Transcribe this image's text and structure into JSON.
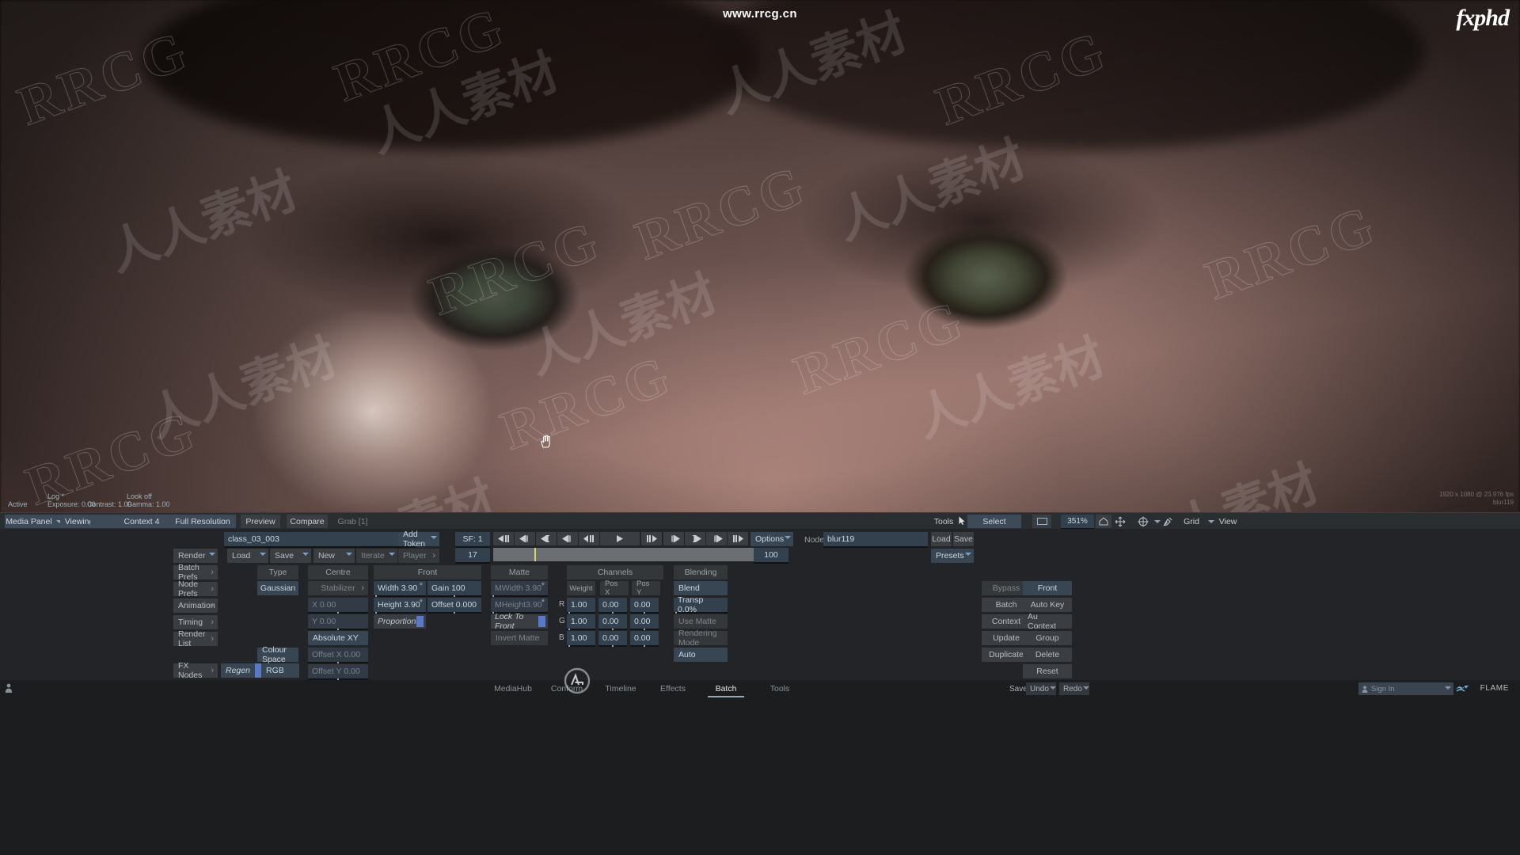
{
  "watermarks": {
    "url": "www.rrcg.cn",
    "brand": "fxphd",
    "rrcg": "RRCG",
    "cn": "人人素材"
  },
  "viewer": {
    "active_label": "Active",
    "log_label": "Log *",
    "exposure": "Exposure: 0.00",
    "contrast": "Contrast: 1.00",
    "lookoff": "Look off",
    "gamma": "Gamma: 1.00",
    "res_stamp_line1": "1920 x 1080 @ 23.976 fps",
    "res_stamp_line2": "blur119",
    "cursor_icon": "hand-cursor-icon"
  },
  "menubar": {
    "media_panel": "Media Panel",
    "viewing": "Viewing",
    "context": "Context 4",
    "full_resolution": "Full Resolution",
    "preview": "Preview",
    "compare": "Compare",
    "grab": "Grab [1]",
    "tools": "Tools",
    "select": "Select",
    "zoom_value": "351%",
    "grid": "Grid",
    "view": "View",
    "icons": {
      "pointer": "pointer-icon",
      "frame": "frame-icon",
      "home": "home-icon",
      "fit": "fit-to-screen-icon",
      "crosshair": "crosshair-icon",
      "eyedropper": "eyedropper-icon"
    }
  },
  "batch": {
    "setup_name": "class_03_003",
    "add_token": "Add Token",
    "left_column": [
      {
        "label": "Render",
        "style": "grey",
        "dropdown": true
      },
      {
        "label": "Batch Prefs",
        "style": "grey",
        "arrow": true
      },
      {
        "label": "Node Prefs",
        "style": "grey",
        "arrow": true
      },
      {
        "label": "Animation",
        "style": "grey",
        "arrow": true
      },
      {
        "label": "Timing",
        "style": "grey",
        "arrow": true
      },
      {
        "label": "Render List",
        "style": "grey",
        "arrow": true
      }
    ],
    "fx_nodes": "FX Nodes",
    "regen": "Regen",
    "rgb": "RGB",
    "colour_space": "Colour Space",
    "file_row": [
      {
        "label": "Load",
        "dropdown": true
      },
      {
        "label": "Save",
        "dropdown": true
      },
      {
        "label": "New",
        "dropdown": true
      },
      {
        "label": "Iterate",
        "dropdown": true
      },
      {
        "label": "Player",
        "arrow": true
      }
    ],
    "type": "Type",
    "gaussian": "Gaussian",
    "sf_field": "SF: 1",
    "frame_field": "17",
    "options": "Options",
    "options_value": "100",
    "node_label": "Node",
    "node_name": "blur119",
    "transport": [
      "pause-to-start-icon",
      "jump-to-prev-icon",
      "go-to-in-icon",
      "step-back-icon",
      "play-reverse-icon",
      "play-icon",
      "play-pause-icon",
      "step-forward-icon",
      "go-to-out-icon",
      "jump-to-next-icon",
      "pause-to-end-icon"
    ]
  },
  "centre": {
    "title": "Centre",
    "stabilizer": "Stabilizer",
    "x": "X 0.00",
    "y": "Y 0.00",
    "absolute_xy": "Absolute XY",
    "offset_x": "Offset X 0.00",
    "offset_y": "Offset Y 0.00"
  },
  "front": {
    "title": "Front",
    "width": "Width 3.90",
    "gain": "Gain 100",
    "height": "Height 3.90",
    "offset": "Offset 0.000",
    "proportional": "Proportional"
  },
  "matte": {
    "title": "Matte",
    "mwidth": "MWidth 3.90",
    "mheight": "MHeight3.90",
    "lock_to_front": "Lock To Front",
    "invert_matte": "Invert Matte"
  },
  "channels": {
    "title": "Channels",
    "columns": [
      "Weight",
      "Pos X",
      "Pos Y"
    ],
    "rows": [
      {
        "name": "R",
        "values": [
          "1.00",
          "0.00",
          "0.00"
        ]
      },
      {
        "name": "G",
        "values": [
          "1.00",
          "0.00",
          "0.00"
        ]
      },
      {
        "name": "B",
        "values": [
          "1.00",
          "0.00",
          "0.00"
        ]
      }
    ]
  },
  "blending": {
    "title": "Blending",
    "blend": "Blend",
    "transp": "Transp 0.0%",
    "use_matte": "Use Matte",
    "rendering_mode": "Rendering Mode",
    "auto": "Auto"
  },
  "right_panel": {
    "load": "Load",
    "save": "Save",
    "presets": "Presets",
    "bypass": "Bypass",
    "front": "Front",
    "batch": "Batch",
    "auto_key": "Auto Key",
    "context": "Context",
    "au_context": "Au Context",
    "update": "Update",
    "group": "Group",
    "duplicate": "Duplicate",
    "delete": "Delete",
    "reset": "Reset"
  },
  "statusbar": {
    "tabs": [
      {
        "label": "MediaHub",
        "active": false
      },
      {
        "label": "Conform",
        "active": false
      },
      {
        "label": "Timeline",
        "active": false
      },
      {
        "label": "Effects",
        "active": false
      },
      {
        "label": "Batch",
        "active": true
      },
      {
        "label": "Tools",
        "active": false
      }
    ],
    "save": "Save",
    "undo": "Undo",
    "redo": "Redo",
    "sign_in": "Sign In",
    "flame": "FLAME",
    "logo": "autodesk-logo-icon"
  },
  "colors": {
    "panel_bg": "#222427",
    "status_bg": "#1b1d1f",
    "btn_grey": "#3a3d41",
    "btn_blue": "#384553",
    "field_blue": "#33404e",
    "accent": "#5a79c4",
    "playhead": "#d8d66a"
  }
}
